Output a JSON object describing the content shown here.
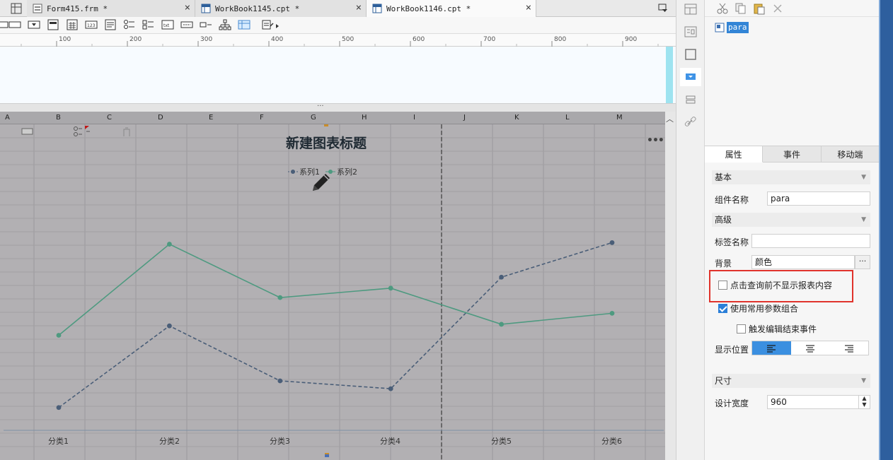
{
  "tabs": [
    {
      "label": "Form415.frm *",
      "close": "×"
    },
    {
      "label": "WorkBook1145.cpt *",
      "close": "×"
    },
    {
      "label": "WorkBook1146.cpt *",
      "close": "×"
    }
  ],
  "ruler": {
    "labels": [
      "100",
      "200",
      "300",
      "400",
      "500",
      "600",
      "700",
      "800",
      "900"
    ]
  },
  "grid": {
    "columns": [
      "A",
      "B",
      "C",
      "D",
      "E",
      "F",
      "G",
      "H",
      "I",
      "J",
      "K",
      "L",
      "M"
    ]
  },
  "chart_data": {
    "type": "line",
    "title": "新建图表标题",
    "categories": [
      "分类1",
      "分类2",
      "分类3",
      "分类4",
      "分类5",
      "分类6"
    ],
    "series": [
      {
        "name": "系列1",
        "color": "#4a5e78",
        "style": "dashed",
        "values": [
          10,
          62,
          27,
          22,
          93,
          115
        ]
      },
      {
        "name": "系列2",
        "color": "#4e9a80",
        "style": "solid",
        "values": [
          56,
          114,
          80,
          86,
          63,
          70
        ]
      }
    ],
    "ylim": [
      0,
      130
    ],
    "legend": "top-center",
    "grid": true
  },
  "panel": {
    "tree_item": "para",
    "tabs": [
      "属性",
      "事件",
      "移动端"
    ],
    "sections": {
      "basic": "基本",
      "advanced": "高级",
      "size": "尺寸"
    },
    "fields": {
      "widget_name_label": "组件名称",
      "widget_name_value": "para",
      "tag_name_label": "标签名称",
      "tag_name_value": "",
      "background_label": "背景",
      "background_value": "颜色",
      "background_button": "···",
      "display_position_label": "显示位置",
      "design_width_label": "设计宽度",
      "design_width_value": "960"
    },
    "checkboxes": {
      "hide_before_query": {
        "label": "点击查询前不显示报表内容",
        "checked": false
      },
      "common_params": {
        "label": "使用常用参数组合",
        "checked": true
      },
      "trigger_edit_end": {
        "label": "触发编辑结束事件",
        "checked": false
      }
    }
  },
  "icons": {
    "more": "more-horizontal-icon",
    "pencil": "pencil-icon"
  }
}
